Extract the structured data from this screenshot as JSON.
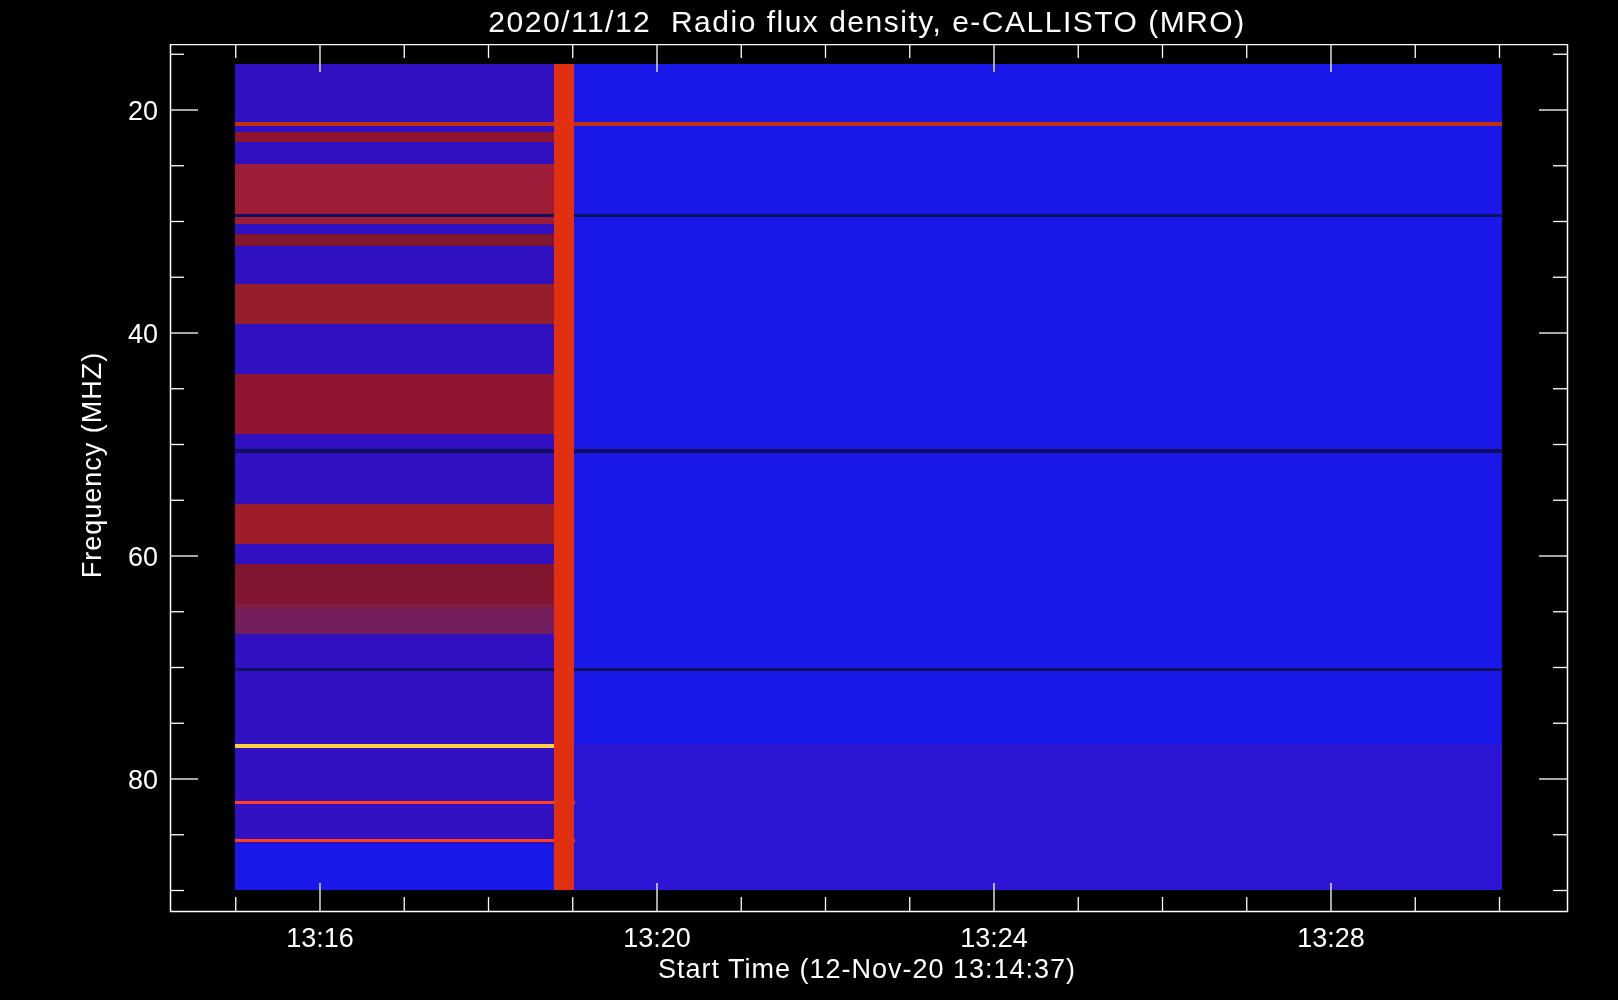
{
  "title": "2020/11/12  Radio flux density, e-CALLISTO (MRO)",
  "y_axis": {
    "label": "Frequency (MHZ)",
    "ticks": [
      "20",
      "40",
      "60",
      "80"
    ]
  },
  "x_axis": {
    "label": "Start Time (12-Nov-20 13:14:37)",
    "ticks": [
      "13:16",
      "13:20",
      "13:24",
      "13:28"
    ]
  }
}
